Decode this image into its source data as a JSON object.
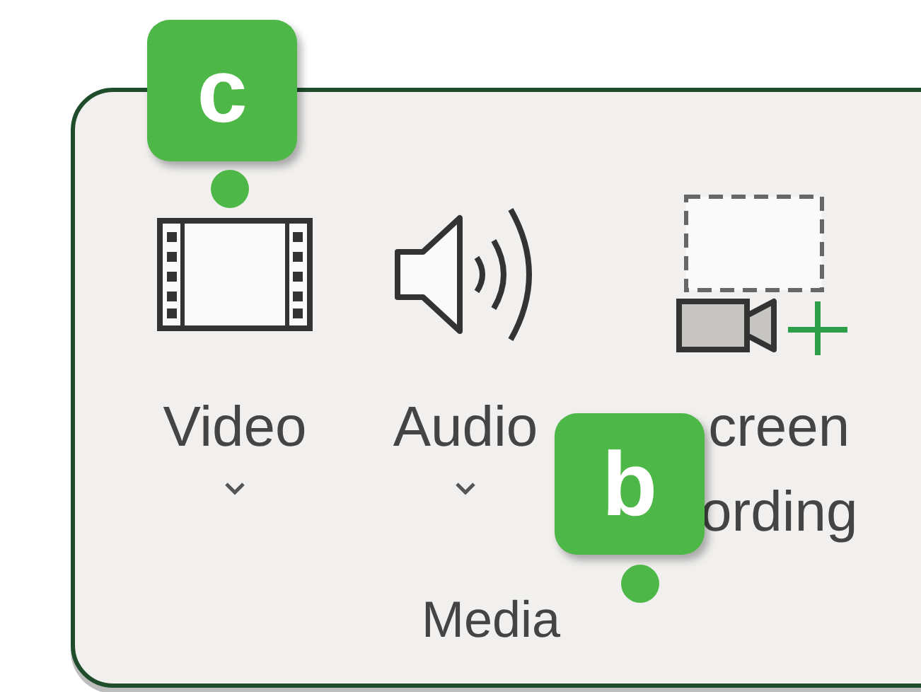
{
  "ribbon_group": {
    "label": "Media",
    "buttons": [
      {
        "kind": "video",
        "label_lines": [
          "Video"
        ],
        "dropdown": true
      },
      {
        "kind": "audio",
        "label_lines": [
          "Audio"
        ],
        "dropdown": true
      },
      {
        "kind": "screen_recording",
        "label_lines": [
          "creen",
          "ording"
        ],
        "dropdown": false
      }
    ]
  },
  "callouts": [
    {
      "label": "c"
    },
    {
      "label": "b"
    }
  ]
}
